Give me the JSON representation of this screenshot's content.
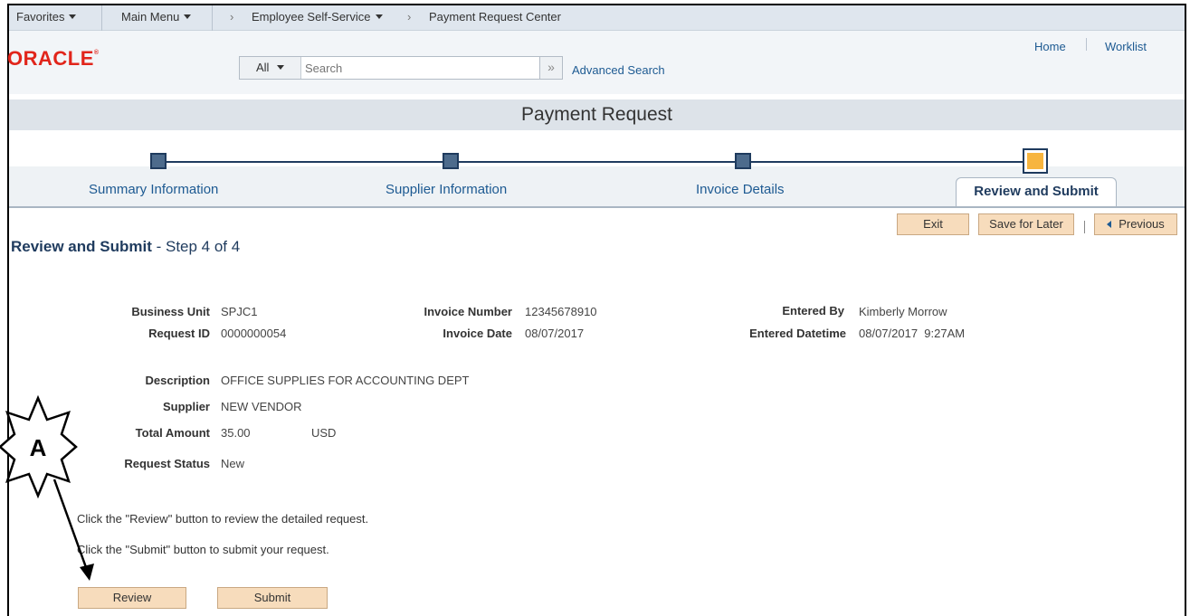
{
  "nav": {
    "favorites": "Favorites",
    "main_menu": "Main Menu",
    "ess": "Employee Self-Service",
    "current": "Payment Request Center",
    "chevron": "›"
  },
  "header": {
    "logo": "ORACLE",
    "search_scope": "All",
    "search_placeholder": "Search",
    "advanced_search": "Advanced Search",
    "home": "Home",
    "worklist": "Worklist"
  },
  "page_title": "Payment Request",
  "train": {
    "steps": [
      {
        "label": "Summary Information"
      },
      {
        "label": "Supplier Information"
      },
      {
        "label": "Invoice Details"
      },
      {
        "label": "Review and Submit"
      }
    ]
  },
  "buttons": {
    "exit": "Exit",
    "save_for_later": "Save for Later",
    "previous": "Previous",
    "review": "Review",
    "submit": "Submit"
  },
  "heading": {
    "bold": "Review and Submit",
    "rest": " - Step 4 of 4"
  },
  "fields": {
    "business_unit": {
      "label": "Business Unit",
      "value": "SPJC1"
    },
    "request_id": {
      "label": "Request ID",
      "value": "0000000054"
    },
    "invoice_number": {
      "label": "Invoice Number",
      "value": "12345678910"
    },
    "invoice_date": {
      "label": "Invoice Date",
      "value": "08/07/2017"
    },
    "entered_by": {
      "label": "Entered By",
      "value": "Kimberly Morrow"
    },
    "entered_datetime": {
      "label": "Entered Datetime",
      "value": "08/07/2017  9:27AM"
    },
    "description": {
      "label": "Description",
      "value": "OFFICE SUPPLIES FOR ACCOUNTING DEPT"
    },
    "supplier": {
      "label": "Supplier",
      "value": "NEW VENDOR"
    },
    "total_amount": {
      "label": "Total Amount",
      "value": "35.00",
      "currency": "USD"
    },
    "request_status": {
      "label": "Request Status",
      "value": "New"
    }
  },
  "instructions": {
    "review": "Click the \"Review\" button to review the detailed request.",
    "submit": "Click the \"Submit\" button to submit your request."
  },
  "callout": {
    "letter": "A"
  },
  "colors": {
    "accent": "#1d5a92",
    "button_bg": "#f7dcbc",
    "active_stop": "#f7b53f",
    "oracle_red": "#e1251b"
  }
}
